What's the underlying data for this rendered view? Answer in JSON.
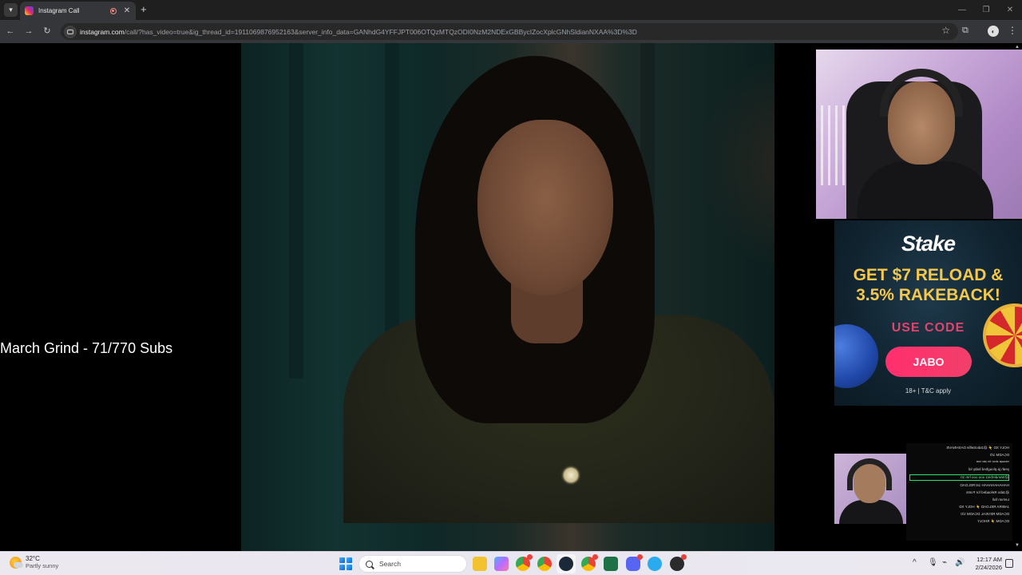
{
  "browser": {
    "tab_title": "Instagram Call",
    "url_domain": "instagram.com",
    "url_path": "/call/?has_video=true&ig_thread_id=1911069876952163&server_info_data=GANhdG4YFFJPT006OTQzMTQzODI0NzM2NDExGBBycIZocXplcGNhSldianNXAA%3D%3D",
    "tab_close_symbol": "✕",
    "new_tab_symbol": "+",
    "back_symbol": "←",
    "forward_symbol": "→",
    "reload_symbol": "↻",
    "star_symbol": "☆",
    "menu_symbol": "⋮",
    "window_controls": [
      "—",
      "❐",
      "✕"
    ]
  },
  "stream": {
    "overlay_text": "March Grind - 71/770 Subs"
  },
  "ad": {
    "brand": "Stake",
    "headline_line1": "GET $7 RELOAD &",
    "headline_line2": "3.5% RAKEBACK!",
    "use_code_label": "USE CODE",
    "code": "JABO",
    "legal": "18+ | T&C apply"
  },
  "chat": {
    "messages": [
      "HOLY XD ⚡ @JaboSelfie DASHNAVE",
      "DCADM 1/0",
      "ᵐᵉˢˢᵃᵍᵉ ᵃᵇᵒᵘᵗ ᵗʰᵉ ʲᵃᵇᵒ ᵇᵉᵃᵗ",
      "yeah ja ploughed baby lol",
      "@Wonderbis1 ooo ooo hm 10",
      "HAHAHAHAHAH 1st RELOAD",
      "@Jabo Reloaded for Fonts",
      "Lemon fall",
      "JABIRA RELOAD ⚡ HOLY XD",
      "DCADM REVEAL DCADM 1/0",
      "DCADM ⚡ RHOLY"
    ]
  },
  "taskbar": {
    "weather_temp": "32°C",
    "weather_desc": "Partly sunny",
    "search_placeholder": "Search",
    "time": "12:17 AM",
    "date": "2/24/2026",
    "tray_chevron": "^",
    "apps": [
      {
        "name": "file-explorer",
        "color": "#f2c230"
      },
      {
        "name": "copilot",
        "color": "#7a5cf0"
      },
      {
        "name": "chrome-profile",
        "color": "#34a853"
      },
      {
        "name": "chrome",
        "color": "#ea4335"
      },
      {
        "name": "steam",
        "color": "#1b2838"
      },
      {
        "name": "chrome-alt",
        "color": "#fbbc05"
      },
      {
        "name": "excel-like",
        "color": "#1e7145"
      },
      {
        "name": "discord",
        "color": "#5865f2"
      },
      {
        "name": "telegram",
        "color": "#2aabee"
      },
      {
        "name": "app-red",
        "color": "#d62b2b"
      }
    ]
  }
}
